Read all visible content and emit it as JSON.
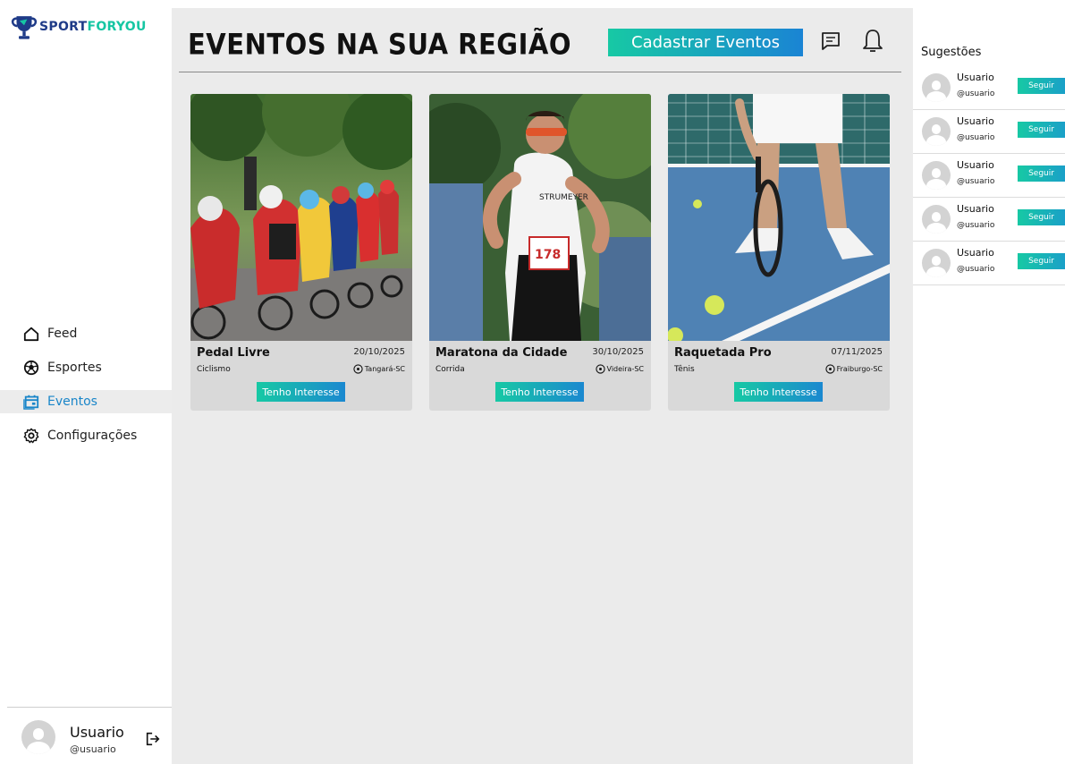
{
  "brand": {
    "part1": "SPORT",
    "part2": "FORYOU"
  },
  "nav": [
    {
      "label": "Feed",
      "icon": "home-icon",
      "active": false
    },
    {
      "label": "Esportes",
      "icon": "ball-icon",
      "active": false
    },
    {
      "label": "Eventos",
      "icon": "calendar-icon",
      "active": true
    },
    {
      "label": "Configurações",
      "icon": "gear-icon",
      "active": false
    }
  ],
  "user": {
    "name": "Usuario",
    "handle": "@usuario"
  },
  "header": {
    "title": "EVENTOS NA SUA REGIÃO",
    "register_label": "Cadastrar Eventos"
  },
  "events": [
    {
      "title": "Pedal Livre",
      "date": "20/10/2025",
      "category": "Ciclismo",
      "location": "Tangará-SC",
      "button": "Tenho Interesse"
    },
    {
      "title": "Maratona da Cidade",
      "date": "30/10/2025",
      "category": "Corrida",
      "location": "Videira-SC",
      "button": "Tenho Interesse"
    },
    {
      "title": "Raquetada Pro",
      "date": "07/11/2025",
      "category": "Tênis",
      "location": "Fraiburgo-SC",
      "button": "Tenho Interesse"
    }
  ],
  "suggestions": {
    "title": "Sugestões",
    "items": [
      {
        "name": "Usuario",
        "handle": "@usuario",
        "button": "Seguir"
      },
      {
        "name": "Usuario",
        "handle": "@usuario",
        "button": "Seguir"
      },
      {
        "name": "Usuario",
        "handle": "@usuario",
        "button": "Seguir"
      },
      {
        "name": "Usuario",
        "handle": "@usuario",
        "button": "Seguir"
      },
      {
        "name": "Usuario",
        "handle": "@usuario",
        "button": "Seguir"
      }
    ]
  },
  "colors": {
    "accent_start": "#17c9a4",
    "accent_end": "#1a84d4",
    "brand_blue": "#1f3b88",
    "active_nav": "#1a86c9"
  }
}
